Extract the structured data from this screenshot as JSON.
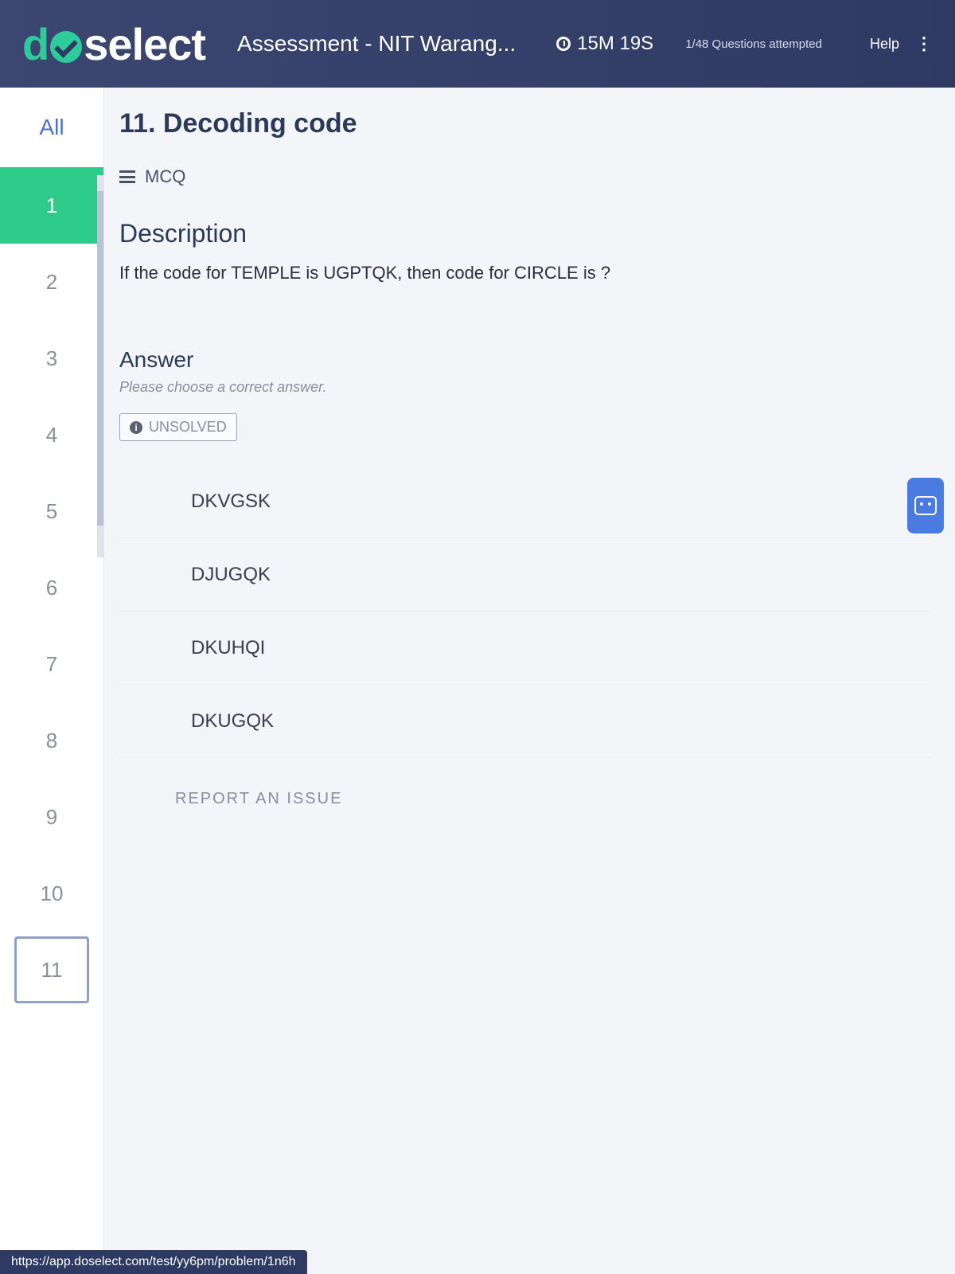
{
  "header": {
    "logo_prefix": "d",
    "logo_suffix": "select",
    "assessment_title": "Assessment - NIT Warang...",
    "timer": "15M 19S",
    "attempted": "1/48 Questions attempted",
    "help": "Help",
    "more": "⋮"
  },
  "sidebar": {
    "all_label": "All",
    "items": [
      {
        "label": "1",
        "state": "answered"
      },
      {
        "label": "2",
        "state": "default"
      },
      {
        "label": "3",
        "state": "default"
      },
      {
        "label": "4",
        "state": "default"
      },
      {
        "label": "5",
        "state": "default"
      },
      {
        "label": "6",
        "state": "default"
      },
      {
        "label": "7",
        "state": "default"
      },
      {
        "label": "8",
        "state": "default"
      },
      {
        "label": "9",
        "state": "default"
      },
      {
        "label": "10",
        "state": "default"
      },
      {
        "label": "11",
        "state": "current"
      }
    ]
  },
  "question": {
    "title": "11. Decoding code",
    "type": "MCQ",
    "description_title": "Description",
    "description_text": "If the code for TEMPLE is UGPTQK, then code for CIRCLE is ?",
    "answer_title": "Answer",
    "answer_hint": "Please choose a correct answer.",
    "status": "UNSOLVED",
    "options": [
      "DKVGSK",
      "DJUGQK",
      "DKUHQI",
      "DKUGQK"
    ],
    "report_link": "REPORT AN ISSUE"
  },
  "status_url": "https://app.doselect.com/test/yy6pm/problem/1n6h",
  "colors": {
    "header_bg": "#2f3a63",
    "brand_green": "#2ecc9a",
    "answered_green": "#2ecc8a",
    "accent_blue": "#4a7be0"
  }
}
